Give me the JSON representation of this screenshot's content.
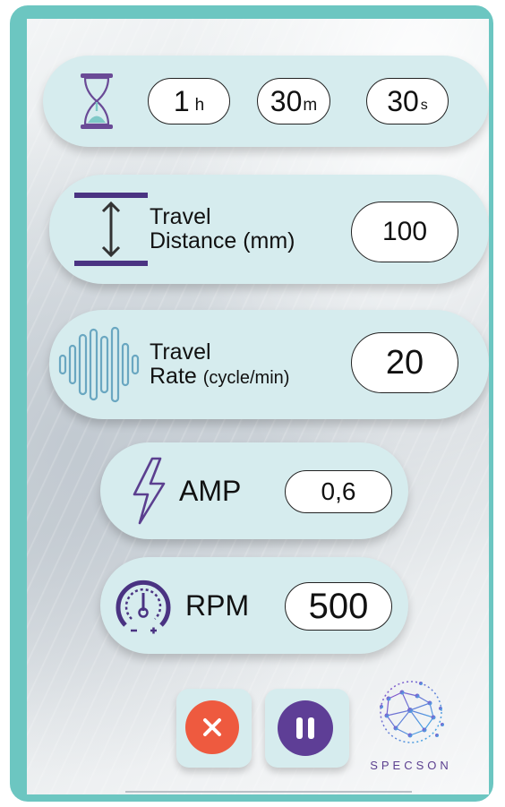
{
  "timer": {
    "hours_value": "1",
    "hours_unit": "h",
    "minutes_value": "30",
    "minutes_unit": "m",
    "seconds_value": "30",
    "seconds_unit": "s"
  },
  "travel_distance": {
    "label_line1": "Travel",
    "label_line2": "Distance (mm)",
    "value": "100"
  },
  "travel_rate": {
    "label_line1": "Travel",
    "label_line2_main": "Rate",
    "label_line2_unit": "(cycle/min)",
    "value": "20"
  },
  "amp": {
    "label": "AMP",
    "value": "0,6"
  },
  "rpm": {
    "label": "RPM",
    "value": "500"
  },
  "controls": {
    "stop_icon": "close-icon",
    "pause_icon": "pause-icon"
  },
  "brand": {
    "name": "SPECSON"
  },
  "colors": {
    "frame": "#6cc6c1",
    "pill": "#d6ecee",
    "accent_purple": "#5b3f8f",
    "stop_red": "#ee5a3f",
    "pause_purple": "#5e3e96"
  },
  "icons": {
    "timer": "hourglass-icon",
    "distance": "vertical-distance-icon",
    "rate": "waveform-icon",
    "amp": "lightning-icon",
    "rpm": "gauge-icon"
  }
}
